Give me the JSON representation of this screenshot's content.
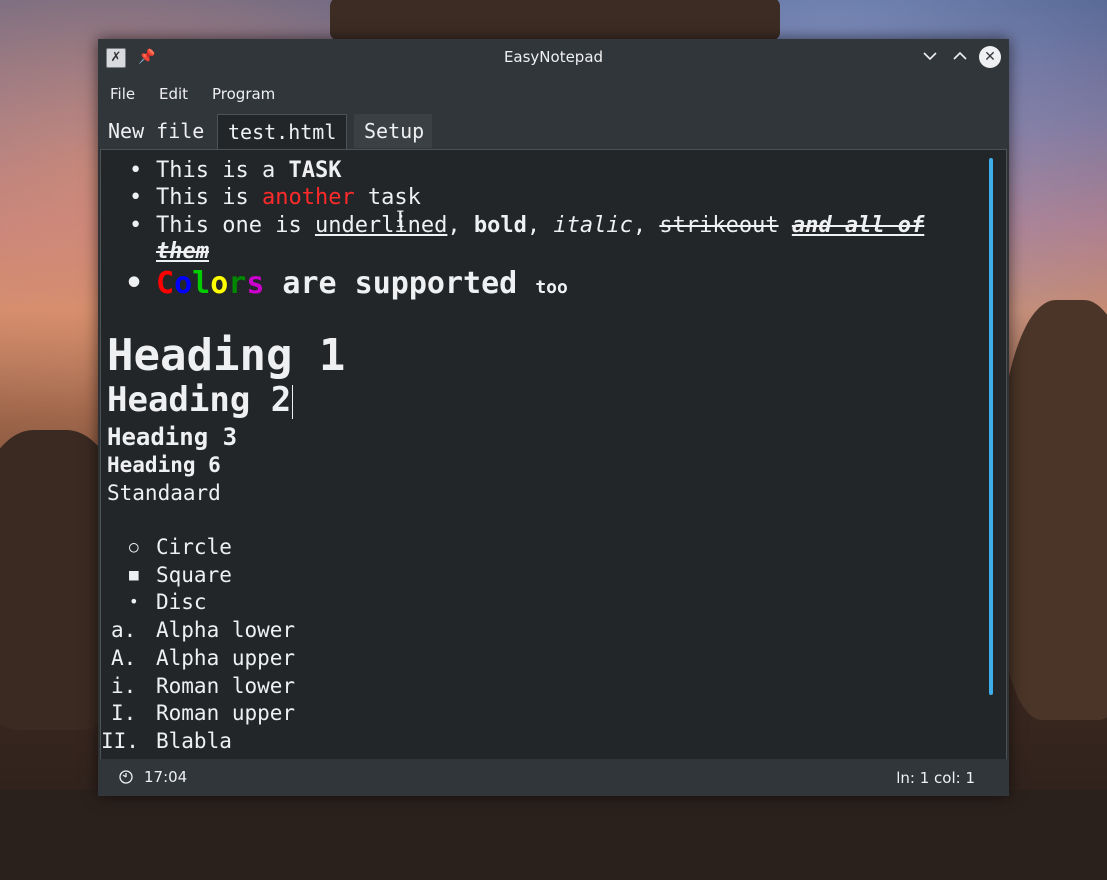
{
  "window": {
    "title": "EasyNotepad"
  },
  "menu": {
    "file": "File",
    "edit": "Edit",
    "program": "Program"
  },
  "tabs": [
    {
      "label": "New file",
      "active": false
    },
    {
      "label": "test.html",
      "active": true
    },
    {
      "label": "Setup",
      "active": false
    }
  ],
  "content": {
    "task1": {
      "plain": "This is a ",
      "bold": "TASK"
    },
    "task2": {
      "plain1": "This is ",
      "red": "another",
      "plain2": " task"
    },
    "task3": {
      "plain": "This one is ",
      "underlined": "underlined",
      "sep1": ", ",
      "bold": "bold",
      "sep2": ", ",
      "italic": "italic",
      "sep3": ", ",
      "strike": "strikeout",
      "all_line1": "and all of",
      "all_line2": "them"
    },
    "colors": {
      "letters": [
        {
          "ch": "C",
          "color": "#ff0000"
        },
        {
          "ch": "o",
          "color": "#0000ff"
        },
        {
          "ch": "l",
          "color": "#00cc00"
        },
        {
          "ch": "o",
          "color": "#ffff00"
        },
        {
          "ch": "r",
          "color": "#008800"
        },
        {
          "ch": "s",
          "color": "#cc00cc"
        }
      ],
      "rest": " are supported ",
      "small": "too"
    },
    "h1": "Heading 1",
    "h2": "Heading 2",
    "h3": "Heading 3",
    "h6": "Heading 6",
    "standard": "Standaard",
    "lists": [
      {
        "marker": "○",
        "text": "Circle"
      },
      {
        "marker": "■",
        "text": "Square"
      },
      {
        "marker": "•",
        "text": "Disc"
      },
      {
        "marker": "a.",
        "text": "Alpha lower"
      },
      {
        "marker": "A.",
        "text": "Alpha upper"
      },
      {
        "marker": "i.",
        "text": "Roman lower"
      },
      {
        "marker": "I.",
        "text": "Roman upper"
      },
      {
        "marker": "II.",
        "text": "Blabla"
      }
    ]
  },
  "status": {
    "time": "17:04",
    "position": "ln: 1 col: 1"
  },
  "colors": {
    "accent": "#3daee9",
    "editor_bg": "#232629",
    "chrome_bg": "#31363b",
    "red_text": "#ff2a2a"
  }
}
